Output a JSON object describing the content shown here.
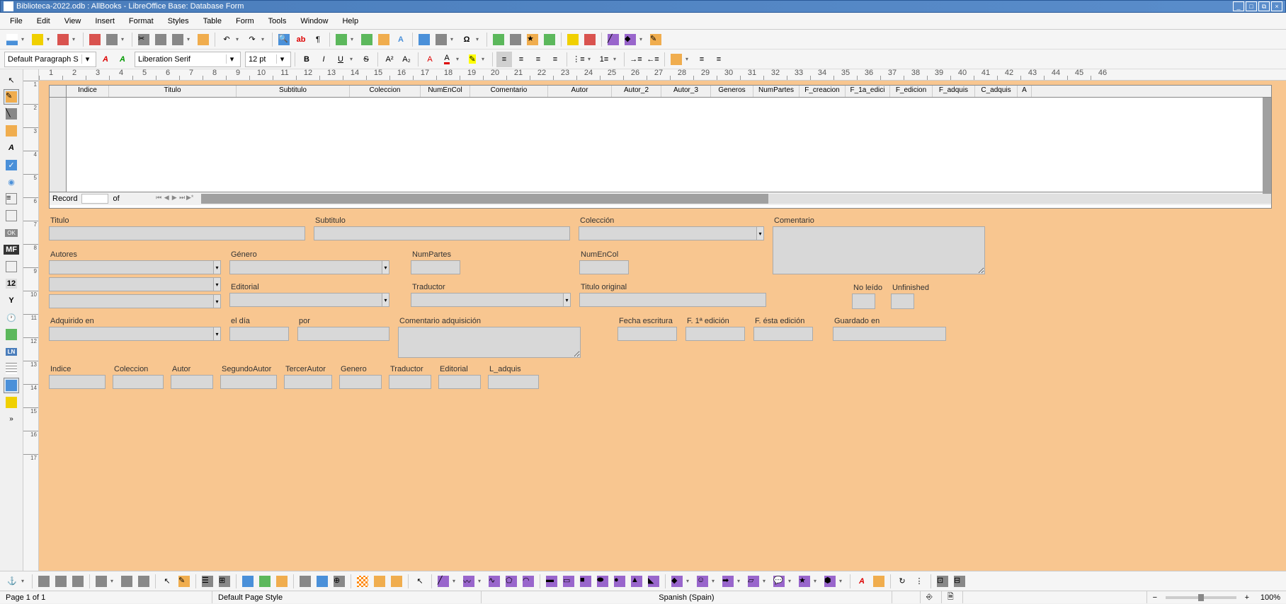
{
  "window": {
    "title": "Biblioteca-2022.odb : AllBooks - LibreOffice Base: Database Form"
  },
  "menu": {
    "file": "File",
    "edit": "Edit",
    "view": "View",
    "insert": "Insert",
    "format": "Format",
    "styles": "Styles",
    "table": "Table",
    "form": "Form",
    "tools": "Tools",
    "window": "Window",
    "help": "Help"
  },
  "formatting": {
    "para_style": "Default Paragraph S",
    "font_name": "Liberation Serif",
    "font_size": "12 pt"
  },
  "grid": {
    "record_label": "Record",
    "of_label": "of",
    "columns": [
      "Indice",
      "Titulo",
      "Subtitulo",
      "Coleccion",
      "NumEnCol",
      "Comentario",
      "Autor",
      "Autor_2",
      "Autor_3",
      "Generos",
      "NumPartes",
      "F_creacion",
      "F_1a_edici",
      "F_edicion",
      "F_adquis",
      "C_adquis",
      "A"
    ]
  },
  "form_fields": {
    "titulo": "Titulo",
    "subtitulo": "Subtitulo",
    "coleccion": "Colección",
    "comentario": "Comentario",
    "autores": "Autores",
    "genero": "Género",
    "numpartes": "NumPartes",
    "numencol": "NumEnCol",
    "editorial": "Editorial",
    "traductor": "Traductor",
    "titulo_original": "Titulo original",
    "no_leido": "No leído",
    "unfinished": "Unfinished",
    "adquirido_en": "Adquirido en",
    "el_dia": "el día",
    "por": "por",
    "comentario_adq": "Comentario adquisición",
    "fecha_escritura": "Fecha escritura",
    "f_1a_edicion": "F. 1ª edición",
    "f_esta_edicion": "F. ésta edición",
    "guardado_en": "Guardado en",
    "indice": "Indice",
    "coleccion2": "Coleccion",
    "autor": "Autor",
    "segundo_autor": "SegundoAutor",
    "tercer_autor": "TercerAutor",
    "genero2": "Genero",
    "traductor2": "Traductor",
    "editorial2": "Editorial",
    "l_adquis": "L_adquis"
  },
  "status": {
    "page": "Page 1 of 1",
    "style": "Default Page Style",
    "language": "Spanish (Spain)",
    "zoom": "100%"
  },
  "ruler_max": 46
}
